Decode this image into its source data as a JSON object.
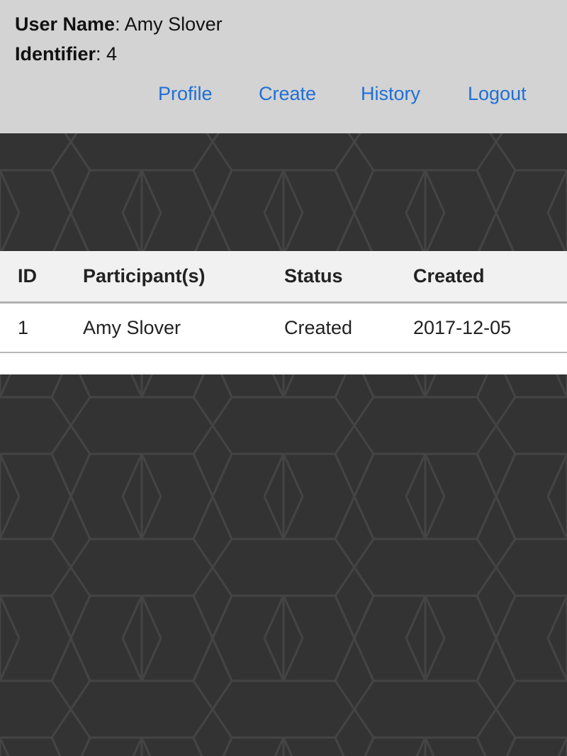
{
  "user": {
    "name_label": "User Name",
    "name_value": "Amy Slover",
    "id_label": "Identifier",
    "id_value": "4"
  },
  "nav": {
    "items": [
      {
        "label": "Profile"
      },
      {
        "label": "Create"
      },
      {
        "label": "History"
      },
      {
        "label": "Logout"
      }
    ]
  },
  "table": {
    "headers": [
      "ID",
      "Participant(s)",
      "Status",
      "Created"
    ],
    "rows": [
      [
        "1",
        "Amy Slover",
        "Created",
        "2017-12-05"
      ]
    ]
  },
  "colors": {
    "header_bg": "#d3d3d3",
    "link": "#1f6fd6",
    "page_bg": "#333333"
  }
}
